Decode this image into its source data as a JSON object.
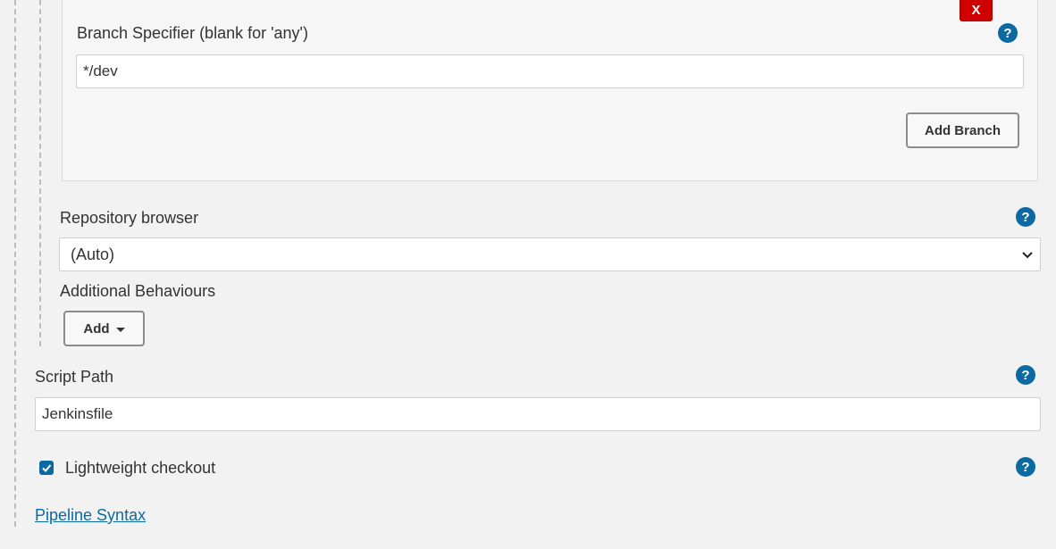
{
  "branch": {
    "delete_label": "X",
    "specifier_label": "Branch Specifier (blank for 'any')",
    "specifier_value": "*/dev",
    "add_branch_label": "Add Branch"
  },
  "repository_browser": {
    "label": "Repository browser",
    "selected": "(Auto)"
  },
  "additional_behaviours": {
    "label": "Additional Behaviours",
    "add_label": "Add"
  },
  "script_path": {
    "label": "Script Path",
    "value": "Jenkinsfile"
  },
  "lightweight_checkout": {
    "label": "Lightweight checkout",
    "checked": true
  },
  "pipeline_syntax_link": "Pipeline Syntax",
  "help_glyph": "?",
  "colors": {
    "accent": "#0b6aa2",
    "danger": "#d10000",
    "background": "#f2f2f2"
  }
}
